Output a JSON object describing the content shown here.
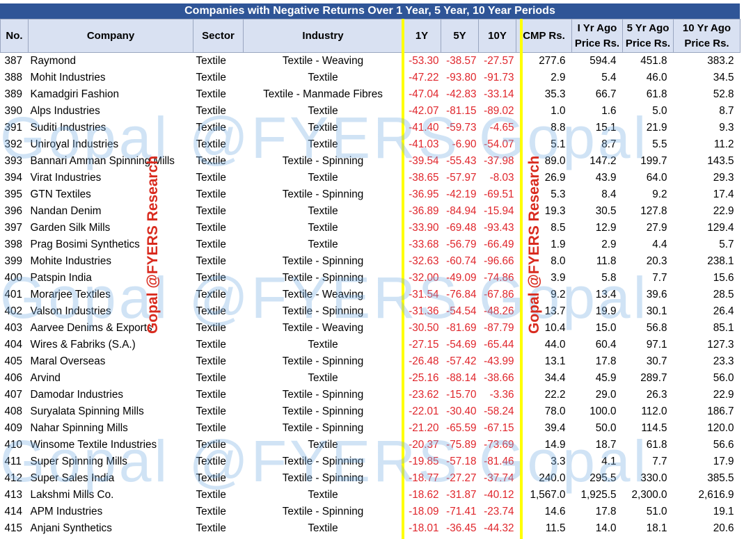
{
  "title": "Companies with Negative Returns Over 1 Year, 5 Year, 10 Year Periods",
  "headers": {
    "no": "No.",
    "company": "Company",
    "sector": "Sector",
    "industry": "Industry",
    "y1": "1Y",
    "y5": "5Y",
    "y10": "10Y",
    "cmp": "CMP Rs.",
    "p1_a": "I Yr Ago",
    "p1_b": "Price Rs.",
    "p5_a": "5 Yr Ago",
    "p5_b": "Price Rs.",
    "p10_a": "10 Yr Ago",
    "p10_b": "Price Rs."
  },
  "watermarks": {
    "horizontal": "Gopal @FYERS Gopal",
    "vertical": "Gopal @FYERS Research"
  },
  "colors": {
    "header_bar": "#2f5597",
    "header_cells": "#d9e1f2",
    "negative": "#e0262c",
    "divider": "#ffff00"
  },
  "rows": [
    {
      "no": "387",
      "company": "Raymond",
      "sector": "Textile",
      "industry": "Textile - Weaving",
      "y1": "-53.30",
      "y5": "-38.57",
      "y10": "-27.57",
      "cmp": "277.6",
      "p1": "594.4",
      "p5": "451.8",
      "p10": "383.2"
    },
    {
      "no": "388",
      "company": "Mohit Industries",
      "sector": "Textile",
      "industry": "Textile",
      "y1": "-47.22",
      "y5": "-93.80",
      "y10": "-91.73",
      "cmp": "2.9",
      "p1": "5.4",
      "p5": "46.0",
      "p10": "34.5"
    },
    {
      "no": "389",
      "company": "Kamadgiri Fashion",
      "sector": "Textile",
      "industry": "Textile - Manmade  Fibres",
      "y1": "-47.04",
      "y5": "-42.83",
      "y10": "-33.14",
      "cmp": "35.3",
      "p1": "66.7",
      "p5": "61.8",
      "p10": "52.8"
    },
    {
      "no": "390",
      "company": "Alps Industries",
      "sector": "Textile",
      "industry": "Textile",
      "y1": "-42.07",
      "y5": "-81.15",
      "y10": "-89.02",
      "cmp": "1.0",
      "p1": "1.6",
      "p5": "5.0",
      "p10": "8.7"
    },
    {
      "no": "391",
      "company": "Suditi Industries",
      "sector": "Textile",
      "industry": "Textile",
      "y1": "-41.40",
      "y5": "-59.73",
      "y10": "-4.65",
      "cmp": "8.8",
      "p1": "15.1",
      "p5": "21.9",
      "p10": "9.3"
    },
    {
      "no": "392",
      "company": "Uniroyal Industries",
      "sector": "Textile",
      "industry": "Textile",
      "y1": "-41.03",
      "y5": "-6.90",
      "y10": "-54.07",
      "cmp": "5.1",
      "p1": "8.7",
      "p5": "5.5",
      "p10": "11.2"
    },
    {
      "no": "393",
      "company": "Bannari Amman Spinning Mills",
      "sector": "Textile",
      "industry": "Textile - Spinning",
      "y1": "-39.54",
      "y5": "-55.43",
      "y10": "-37.98",
      "cmp": "89.0",
      "p1": "147.2",
      "p5": "199.7",
      "p10": "143.5"
    },
    {
      "no": "394",
      "company": "Virat Industries",
      "sector": "Textile",
      "industry": "Textile",
      "y1": "-38.65",
      "y5": "-57.97",
      "y10": "-8.03",
      "cmp": "26.9",
      "p1": "43.9",
      "p5": "64.0",
      "p10": "29.3"
    },
    {
      "no": "395",
      "company": "GTN Textiles",
      "sector": "Textile",
      "industry": "Textile - Spinning",
      "y1": "-36.95",
      "y5": "-42.19",
      "y10": "-69.51",
      "cmp": "5.3",
      "p1": "8.4",
      "p5": "9.2",
      "p10": "17.4"
    },
    {
      "no": "396",
      "company": "Nandan Denim",
      "sector": "Textile",
      "industry": "Textile",
      "y1": "-36.89",
      "y5": "-84.94",
      "y10": "-15.94",
      "cmp": "19.3",
      "p1": "30.5",
      "p5": "127.8",
      "p10": "22.9"
    },
    {
      "no": "397",
      "company": "Garden Silk Mills",
      "sector": "Textile",
      "industry": "Textile",
      "y1": "-33.90",
      "y5": "-69.48",
      "y10": "-93.43",
      "cmp": "8.5",
      "p1": "12.9",
      "p5": "27.9",
      "p10": "129.4"
    },
    {
      "no": "398",
      "company": "Prag Bosimi Synthetics",
      "sector": "Textile",
      "industry": "Textile",
      "y1": "-33.68",
      "y5": "-56.79",
      "y10": "-66.49",
      "cmp": "1.9",
      "p1": "2.9",
      "p5": "4.4",
      "p10": "5.7"
    },
    {
      "no": "399",
      "company": "Mohite Industries",
      "sector": "Textile",
      "industry": "Textile - Spinning",
      "y1": "-32.63",
      "y5": "-60.74",
      "y10": "-96.66",
      "cmp": "8.0",
      "p1": "11.8",
      "p5": "20.3",
      "p10": "238.1"
    },
    {
      "no": "400",
      "company": "Patspin India",
      "sector": "Textile",
      "industry": "Textile - Spinning",
      "y1": "-32.00",
      "y5": "-49.09",
      "y10": "-74.86",
      "cmp": "3.9",
      "p1": "5.8",
      "p5": "7.7",
      "p10": "15.6"
    },
    {
      "no": "401",
      "company": "Morarjee Textiles",
      "sector": "Textile",
      "industry": "Textile - Weaving",
      "y1": "-31.54",
      "y5": "-76.84",
      "y10": "-67.86",
      "cmp": "9.2",
      "p1": "13.4",
      "p5": "39.6",
      "p10": "28.5"
    },
    {
      "no": "402",
      "company": "Valson Industries",
      "sector": "Textile",
      "industry": "Textile - Spinning",
      "y1": "-31.36",
      "y5": "-54.54",
      "y10": "-48.26",
      "cmp": "13.7",
      "p1": "19.9",
      "p5": "30.1",
      "p10": "26.4"
    },
    {
      "no": "403",
      "company": "Aarvee Denims & Exports",
      "sector": "Textile",
      "industry": "Textile - Weaving",
      "y1": "-30.50",
      "y5": "-81.69",
      "y10": "-87.79",
      "cmp": "10.4",
      "p1": "15.0",
      "p5": "56.8",
      "p10": "85.1"
    },
    {
      "no": "404",
      "company": "Wires & Fabriks (S.A.)",
      "sector": "Textile",
      "industry": "Textile",
      "y1": "-27.15",
      "y5": "-54.69",
      "y10": "-65.44",
      "cmp": "44.0",
      "p1": "60.4",
      "p5": "97.1",
      "p10": "127.3"
    },
    {
      "no": "405",
      "company": "Maral Overseas",
      "sector": "Textile",
      "industry": "Textile - Spinning",
      "y1": "-26.48",
      "y5": "-57.42",
      "y10": "-43.99",
      "cmp": "13.1",
      "p1": "17.8",
      "p5": "30.7",
      "p10": "23.3"
    },
    {
      "no": "406",
      "company": "Arvind",
      "sector": "Textile",
      "industry": "Textile",
      "y1": "-25.16",
      "y5": "-88.14",
      "y10": "-38.66",
      "cmp": "34.4",
      "p1": "45.9",
      "p5": "289.7",
      "p10": "56.0"
    },
    {
      "no": "407",
      "company": "Damodar Industries",
      "sector": "Textile",
      "industry": "Textile - Spinning",
      "y1": "-23.62",
      "y5": "-15.70",
      "y10": "-3.36",
      "cmp": "22.2",
      "p1": "29.0",
      "p5": "26.3",
      "p10": "22.9"
    },
    {
      "no": "408",
      "company": "Suryalata Spinning Mills",
      "sector": "Textile",
      "industry": "Textile - Spinning",
      "y1": "-22.01",
      "y5": "-30.40",
      "y10": "-58.24",
      "cmp": "78.0",
      "p1": "100.0",
      "p5": "112.0",
      "p10": "186.7"
    },
    {
      "no": "409",
      "company": "Nahar Spinning Mills",
      "sector": "Textile",
      "industry": "Textile - Spinning",
      "y1": "-21.20",
      "y5": "-65.59",
      "y10": "-67.15",
      "cmp": "39.4",
      "p1": "50.0",
      "p5": "114.5",
      "p10": "120.0"
    },
    {
      "no": "410",
      "company": "Winsome Textile Industries",
      "sector": "Textile",
      "industry": "Textile",
      "y1": "-20.37",
      "y5": "-75.89",
      "y10": "-73.69",
      "cmp": "14.9",
      "p1": "18.7",
      "p5": "61.8",
      "p10": "56.6"
    },
    {
      "no": "411",
      "company": "Super Spinning Mills",
      "sector": "Textile",
      "industry": "Textile - Spinning",
      "y1": "-19.85",
      "y5": "-57.18",
      "y10": "-81.46",
      "cmp": "3.3",
      "p1": "4.1",
      "p5": "7.7",
      "p10": "17.9"
    },
    {
      "no": "412",
      "company": "Super Sales India",
      "sector": "Textile",
      "industry": "Textile - Spinning",
      "y1": "-18.77",
      "y5": "-27.27",
      "y10": "-37.74",
      "cmp": "240.0",
      "p1": "295.5",
      "p5": "330.0",
      "p10": "385.5"
    },
    {
      "no": "413",
      "company": "Lakshmi Mills Co.",
      "sector": "Textile",
      "industry": "Textile",
      "y1": "-18.62",
      "y5": "-31.87",
      "y10": "-40.12",
      "cmp": "1,567.0",
      "p1": "1,925.5",
      "p5": "2,300.0",
      "p10": "2,616.9"
    },
    {
      "no": "414",
      "company": "APM Industries",
      "sector": "Textile",
      "industry": "Textile - Spinning",
      "y1": "-18.09",
      "y5": "-71.41",
      "y10": "-23.74",
      "cmp": "14.6",
      "p1": "17.8",
      "p5": "51.0",
      "p10": "19.1"
    },
    {
      "no": "415",
      "company": "Anjani Synthetics",
      "sector": "Textile",
      "industry": "Textile",
      "y1": "-18.01",
      "y5": "-36.45",
      "y10": "-44.32",
      "cmp": "11.5",
      "p1": "14.0",
      "p5": "18.1",
      "p10": "20.6"
    }
  ]
}
